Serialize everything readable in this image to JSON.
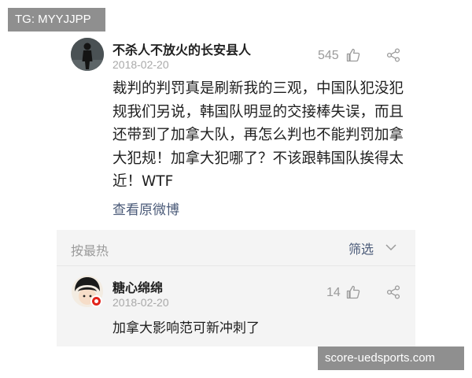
{
  "watermarks": {
    "top_left": "TG: MYYJJPP",
    "bottom_right": "score-uedsports.com"
  },
  "post": {
    "username": "不杀人不放火的长安县人",
    "date": "2018-02-20",
    "like_count": "545",
    "text": "裁判的判罚真是刷新我的三观，中国队犯没犯规我们另说，韩国队明显的交接棒失误，而且还带到了加拿大队，再怎么判也不能判罚加拿大犯规！加拿大犯哪了？不该跟韩国队挨得太近！WTF",
    "view_original": "查看原微博",
    "avatar_icon": "person-silhouette-icon"
  },
  "comments": {
    "sort_label": "按最热",
    "filter_label": "筛选",
    "filter_icon": "chevron-down-icon",
    "items": [
      {
        "username": "糖心绵绵",
        "date": "2018-02-20",
        "like_count": "14",
        "text": "加拿大影响范可新冲刺了",
        "avatar_icon": "cartoon-avatar-icon",
        "badge_icon": "verified-badge-icon"
      }
    ]
  },
  "icons": {
    "like": "thumbs-up-icon",
    "share": "share-icon"
  },
  "colors": {
    "link": "#4a5a78",
    "muted": "#9a9a9a",
    "panel_bg": "#f4f4f4",
    "badge": "#e2231a",
    "watermark_bg": "#8f8f8f"
  }
}
